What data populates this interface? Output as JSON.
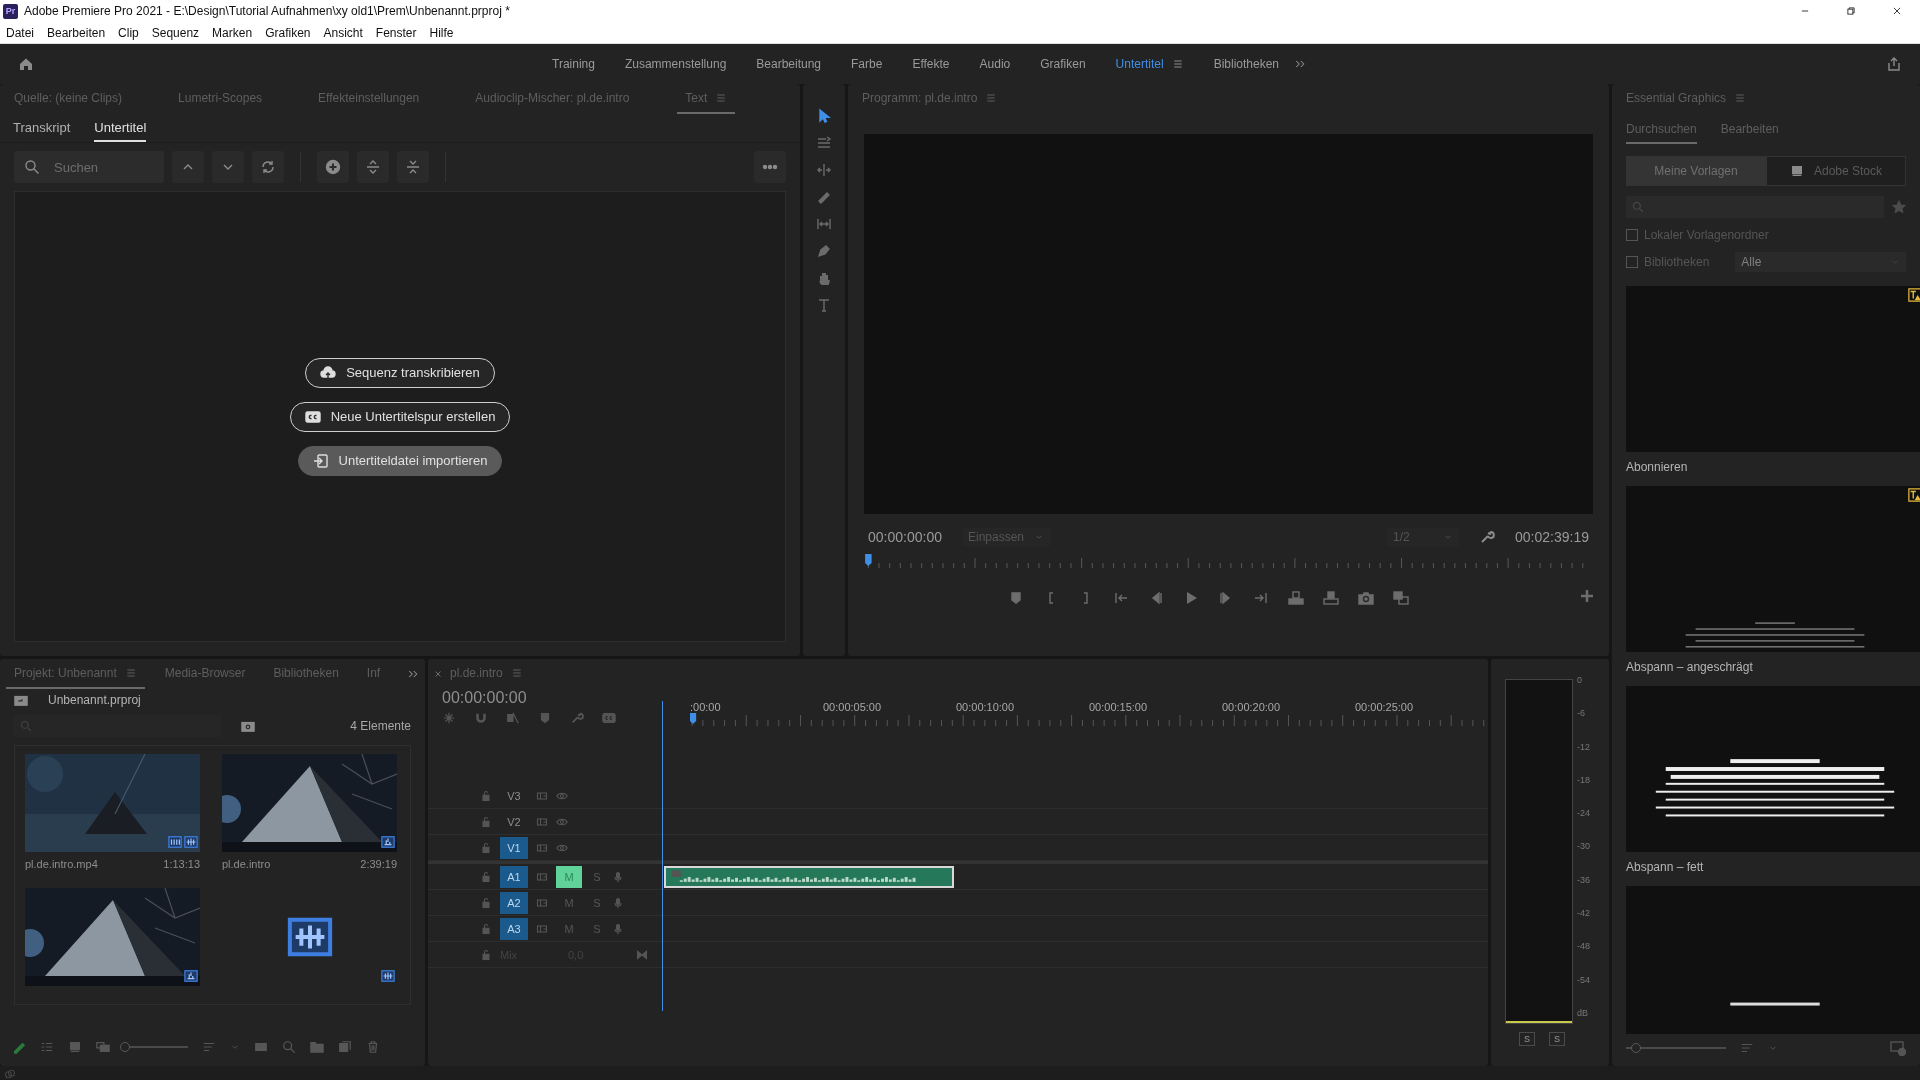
{
  "title_bar": {
    "badge": "Pr",
    "title": "Adobe Premiere Pro 2021 - E:\\Design\\Tutorial Aufnahmen\\xy old1\\Prem\\Unbenannt.prproj *"
  },
  "menu": [
    "Datei",
    "Bearbeiten",
    "Clip",
    "Sequenz",
    "Marken",
    "Grafiken",
    "Ansicht",
    "Fenster",
    "Hilfe"
  ],
  "workspaces": [
    {
      "label": "Training",
      "selected": false
    },
    {
      "label": "Zusammenstellung",
      "selected": false
    },
    {
      "label": "Bearbeitung",
      "selected": false
    },
    {
      "label": "Farbe",
      "selected": false
    },
    {
      "label": "Effekte",
      "selected": false
    },
    {
      "label": "Audio",
      "selected": false
    },
    {
      "label": "Grafiken",
      "selected": false
    },
    {
      "label": "Untertitel",
      "selected": true
    },
    {
      "label": "Bibliotheken",
      "selected": false
    }
  ],
  "text_panel": {
    "tabs": [
      {
        "label": "Quelle: (keine Clips)",
        "selected": false
      },
      {
        "label": "Lumetri-Scopes",
        "selected": false
      },
      {
        "label": "Effekteinstellungen",
        "selected": false
      },
      {
        "label": "Audioclip-Mischer: pl.de.intro",
        "selected": false
      },
      {
        "label": "Text",
        "selected": true
      }
    ],
    "subtabs": [
      {
        "label": "Transkript",
        "selected": false
      },
      {
        "label": "Untertitel",
        "selected": true
      }
    ],
    "search": {
      "placeholder": "Suchen"
    },
    "actions": [
      {
        "label": "Sequenz transkribieren",
        "kind": "cloud",
        "highlighted": false
      },
      {
        "label": "Neue Untertitelspur erstellen",
        "kind": "captions",
        "highlighted": false
      },
      {
        "label": "Untertiteldatei importieren",
        "kind": "import",
        "highlighted": true
      }
    ]
  },
  "program_monitor": {
    "title": "Programm: pl.de.intro",
    "timecode": "00:00:00:00",
    "zoom": "Einpassen",
    "resolution": "1/2",
    "duration": "00:02:39:19"
  },
  "essential_graphics": {
    "title": "Essential Graphics",
    "tabs": [
      {
        "label": "Durchsuchen",
        "selected": true
      },
      {
        "label": "Bearbeiten",
        "selected": false
      }
    ],
    "sources": [
      {
        "label": "Meine Vorlagen",
        "selected": true
      },
      {
        "label": "Adobe Stock",
        "selected": false
      }
    ],
    "checkboxes": [
      {
        "label": "Lokaler Vorlagenordner",
        "checked": false
      },
      {
        "label": "Bibliotheken",
        "checked": false
      }
    ],
    "library_dropdown": "Alle",
    "templates": [
      {
        "name": "Abonnieren",
        "kind": "blank",
        "warning": true
      },
      {
        "name": "Abspann – angeschrägt",
        "kind": "credits",
        "warning": true
      },
      {
        "name": "Abspann – fett",
        "kind": "credits-bold",
        "warning": false
      },
      {
        "kind": "credits-bottom",
        "warning": false
      }
    ],
    "zoom_slider": {
      "level": 0.1
    }
  },
  "project": {
    "tabs": [
      {
        "label": "Projekt: Unbenannt",
        "selected": true
      },
      {
        "label": "Media-Browser",
        "selected": false
      },
      {
        "label": "Bibliotheken",
        "selected": false
      },
      {
        "label": "Inf",
        "selected": false
      }
    ],
    "file": "Unbenannt.prproj",
    "count": "4 Elemente",
    "items": [
      {
        "name": "pl.de.intro.mp4",
        "duration": "1:13:13",
        "kind": "video"
      },
      {
        "name": "pl.de.intro",
        "duration": "2:39:19",
        "kind": "sequence"
      },
      {
        "kind": "sequence"
      },
      {
        "kind": "audio"
      }
    ],
    "zoom_slider": {
      "level": 0.02
    }
  },
  "timeline": {
    "title": "pl.de.intro",
    "timecode": "00:00:00:00",
    "ruler": [
      ":00:00",
      "00:00:05:00",
      "00:00:10:00",
      "00:00:15:00",
      "00:00:20:00",
      "00:00:25:00"
    ],
    "tracks": [
      {
        "label": "V3",
        "kind": "video",
        "targeted": false
      },
      {
        "label": "V2",
        "kind": "video",
        "targeted": false
      },
      {
        "label": "V1",
        "kind": "video",
        "targeted": true
      },
      {
        "label": "A1",
        "kind": "audio",
        "targeted": true,
        "mute": "M",
        "solo": "S",
        "muted": true
      },
      {
        "label": "A2",
        "kind": "audio",
        "targeted": true,
        "mute": "M",
        "solo": "S",
        "muted": false
      },
      {
        "label": "A3",
        "kind": "audio",
        "targeted": true,
        "mute": "M",
        "solo": "S",
        "muted": false
      }
    ],
    "mix": {
      "label": "Mix",
      "value": "0,0"
    }
  },
  "meter": {
    "scale": [
      "0",
      "-6",
      "-12",
      "-18",
      "-24",
      "-30",
      "-36",
      "-42",
      "-48",
      "-54",
      "dB"
    ],
    "solo": [
      "S",
      "S"
    ]
  }
}
